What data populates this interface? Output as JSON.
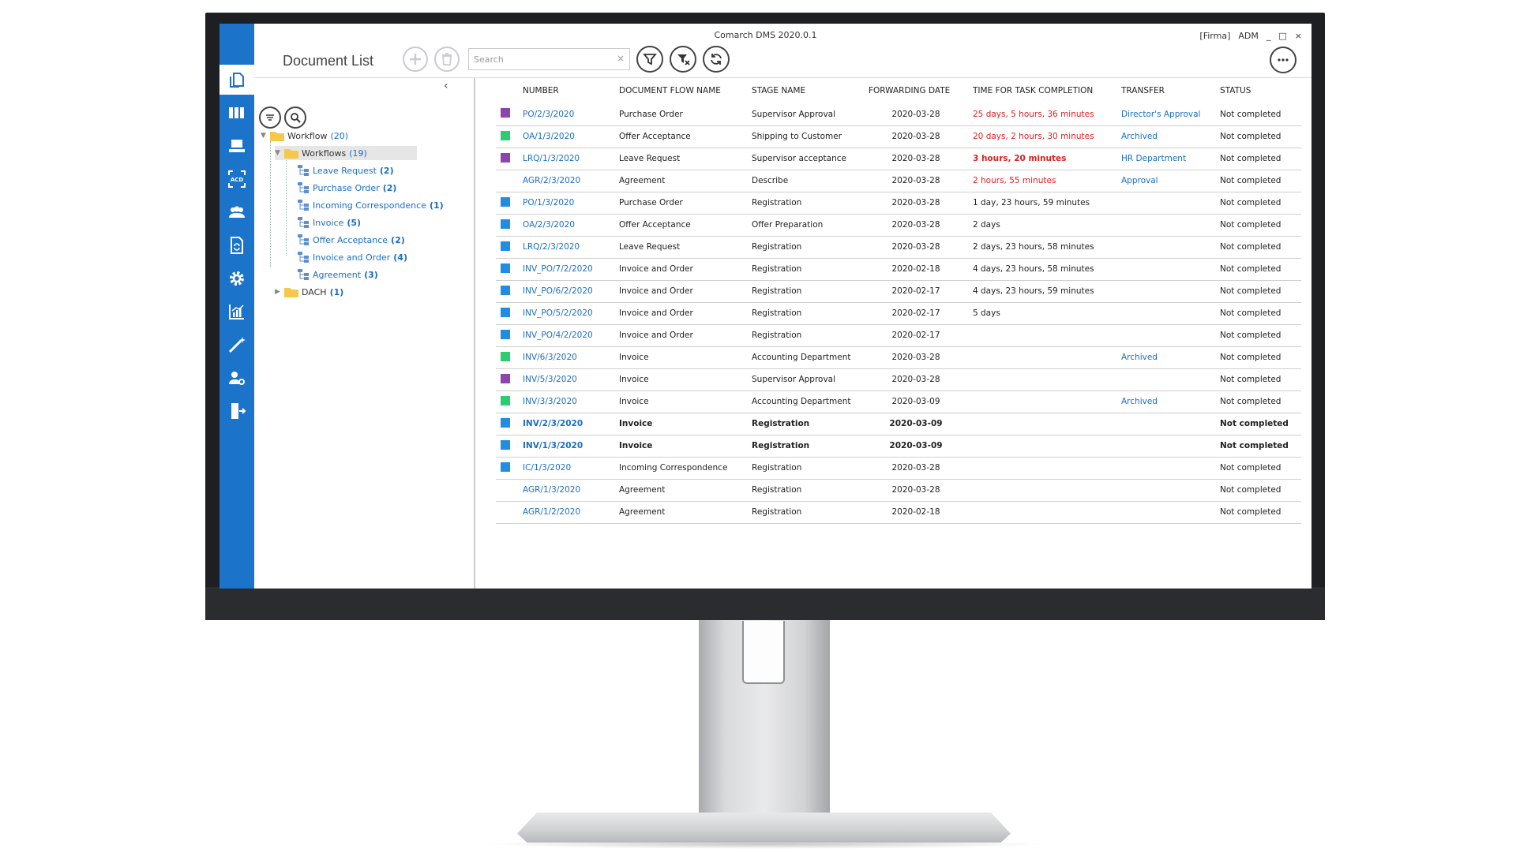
{
  "window": {
    "title": "Comarch DMS 2020.0.1",
    "company": "[Firma]",
    "user": "ADM",
    "minimize": "_",
    "maximize": "□",
    "close": "×"
  },
  "page_title": "Document List",
  "search": {
    "placeholder": "Search",
    "clear": "×"
  },
  "sidebar": {
    "items": [
      {
        "name": "documents-icon",
        "active": true
      },
      {
        "name": "binders-icon"
      },
      {
        "name": "workstation-icon"
      },
      {
        "name": "ocr-acd-icon"
      },
      {
        "name": "users-icon"
      },
      {
        "name": "document-sync-icon"
      },
      {
        "name": "settings-gear-icon"
      },
      {
        "name": "reports-chart-icon"
      },
      {
        "name": "magic-wand-icon"
      },
      {
        "name": "user-settings-icon"
      },
      {
        "name": "logout-icon"
      }
    ]
  },
  "tree": {
    "root": {
      "label": "Workflow",
      "count": "(20)"
    },
    "workflows": {
      "label": "Workflows",
      "count": "(19)"
    },
    "children": [
      {
        "label": "Leave Request",
        "count": "(2)"
      },
      {
        "label": "Purchase Order",
        "count": "(2)"
      },
      {
        "label": "Incoming Correspondence",
        "count": "(1)"
      },
      {
        "label": "Invoice",
        "count": "(5)"
      },
      {
        "label": "Offer Acceptance",
        "count": "(2)"
      },
      {
        "label": "Invoice and Order",
        "count": "(4)"
      },
      {
        "label": "Agreement",
        "count": "(3)"
      }
    ],
    "dach": {
      "label": "DACH",
      "count": "(1)"
    }
  },
  "columns": [
    "NUMBER",
    "DOCUMENT FLOW NAME",
    "STAGE NAME",
    "FORWARDING DATE",
    "TIME FOR TASK COMPLETION",
    "TRANSFER",
    "STATUS"
  ],
  "colors": {
    "purple": "#8e44ad",
    "green": "#2ecc71",
    "blue": "#1f8ee0",
    "accent": "#1b74c9",
    "red": "#e02020"
  },
  "rows": [
    {
      "marker": "purple",
      "number": "PO/2/3/2020",
      "flow": "Purchase Order",
      "stage": "Supervisor Approval",
      "date": "2020-03-28",
      "time": "25 days, 5 hours, 36 minutes",
      "time_style": "red",
      "transfer": "Director's Approval",
      "status": "Not completed"
    },
    {
      "marker": "green",
      "number": "OA/1/3/2020",
      "flow": "Offer Acceptance",
      "stage": "Shipping to Customer",
      "date": "2020-03-28",
      "time": "20 days, 2 hours, 30 minutes",
      "time_style": "red",
      "transfer": "Archived",
      "status": "Not completed"
    },
    {
      "marker": "purple",
      "number": "LRQ/1/3/2020",
      "flow": "Leave Request",
      "stage": "Supervisor acceptance",
      "date": "2020-03-28",
      "time": "3 hours, 20 minutes",
      "time_style": "red-bold",
      "transfer": "HR Department",
      "status": "Not completed"
    },
    {
      "marker": "",
      "number": "AGR/2/3/2020",
      "flow": "Agreement",
      "stage": "Describe",
      "date": "2020-03-28",
      "time": "2 hours, 55 minutes",
      "time_style": "red",
      "transfer": "Approval",
      "status": "Not completed"
    },
    {
      "marker": "blue",
      "number": "PO/1/3/2020",
      "flow": "Purchase Order",
      "stage": "Registration",
      "date": "2020-03-28",
      "time": "1 day, 23 hours, 59 minutes",
      "time_style": "dark",
      "transfer": "",
      "status": "Not completed"
    },
    {
      "marker": "blue",
      "number": "OA/2/3/2020",
      "flow": "Offer Acceptance",
      "stage": "Offer Preparation",
      "date": "2020-03-28",
      "time": "2 days",
      "time_style": "dark",
      "transfer": "",
      "status": "Not completed"
    },
    {
      "marker": "blue",
      "number": "LRQ/2/3/2020",
      "flow": "Leave Request",
      "stage": "Registration",
      "date": "2020-03-28",
      "time": "2 days, 23 hours, 58 minutes",
      "time_style": "dark",
      "transfer": "",
      "status": "Not completed"
    },
    {
      "marker": "blue",
      "number": "INV_PO/7/2/2020",
      "flow": "Invoice and Order",
      "stage": "Registration",
      "date": "2020-02-18",
      "time": "4 days, 23 hours, 58 minutes",
      "time_style": "dark",
      "transfer": "",
      "status": "Not completed"
    },
    {
      "marker": "blue",
      "number": "INV_PO/6/2/2020",
      "flow": "Invoice and Order",
      "stage": "Registration",
      "date": "2020-02-17",
      "time": "4 days, 23 hours, 59 minutes",
      "time_style": "dark",
      "transfer": "",
      "status": "Not completed"
    },
    {
      "marker": "blue",
      "number": "INV_PO/5/2/2020",
      "flow": "Invoice and Order",
      "stage": "Registration",
      "date": "2020-02-17",
      "time": "5 days",
      "time_style": "dark",
      "transfer": "",
      "status": "Not completed"
    },
    {
      "marker": "blue",
      "number": "INV_PO/4/2/2020",
      "flow": "Invoice and Order",
      "stage": "Registration",
      "date": "2020-02-17",
      "time": "",
      "time_style": "dark",
      "transfer": "",
      "status": "Not completed"
    },
    {
      "marker": "green",
      "number": "INV/6/3/2020",
      "flow": "Invoice",
      "stage": "Accounting Department",
      "date": "2020-03-28",
      "time": "",
      "time_style": "dark",
      "transfer": "Archived",
      "status": "Not completed"
    },
    {
      "marker": "purple",
      "number": "INV/5/3/2020",
      "flow": "Invoice",
      "stage": "Supervisor Approval",
      "date": "2020-03-28",
      "time": "",
      "time_style": "dark",
      "transfer": "",
      "status": "Not completed"
    },
    {
      "marker": "green",
      "number": "INV/3/3/2020",
      "flow": "Invoice",
      "stage": "Accounting Department",
      "date": "2020-03-09",
      "time": "",
      "time_style": "dark",
      "transfer": "Archived",
      "status": "Not completed"
    },
    {
      "marker": "blue",
      "number": "INV/2/3/2020",
      "flow": "Invoice",
      "stage": "Registration",
      "date": "2020-03-09",
      "time": "",
      "time_style": "dark",
      "transfer": "",
      "status": "Not completed",
      "bold": true
    },
    {
      "marker": "blue",
      "number": "INV/1/3/2020",
      "flow": "Invoice",
      "stage": "Registration",
      "date": "2020-03-09",
      "time": "",
      "time_style": "dark",
      "transfer": "",
      "status": "Not completed",
      "bold": true
    },
    {
      "marker": "blue",
      "number": "IC/1/3/2020",
      "flow": "Incoming Correspondence",
      "stage": "Registration",
      "date": "2020-03-28",
      "time": "",
      "time_style": "dark",
      "transfer": "",
      "status": "Not completed"
    },
    {
      "marker": "",
      "number": "AGR/1/3/2020",
      "flow": "Agreement",
      "stage": "Registration",
      "date": "2020-03-28",
      "time": "",
      "time_style": "dark",
      "transfer": "",
      "status": "Not completed"
    },
    {
      "marker": "",
      "number": "AGR/1/2/2020",
      "flow": "Agreement",
      "stage": "Registration",
      "date": "2020-02-18",
      "time": "",
      "time_style": "dark",
      "transfer": "",
      "status": "Not completed"
    }
  ]
}
